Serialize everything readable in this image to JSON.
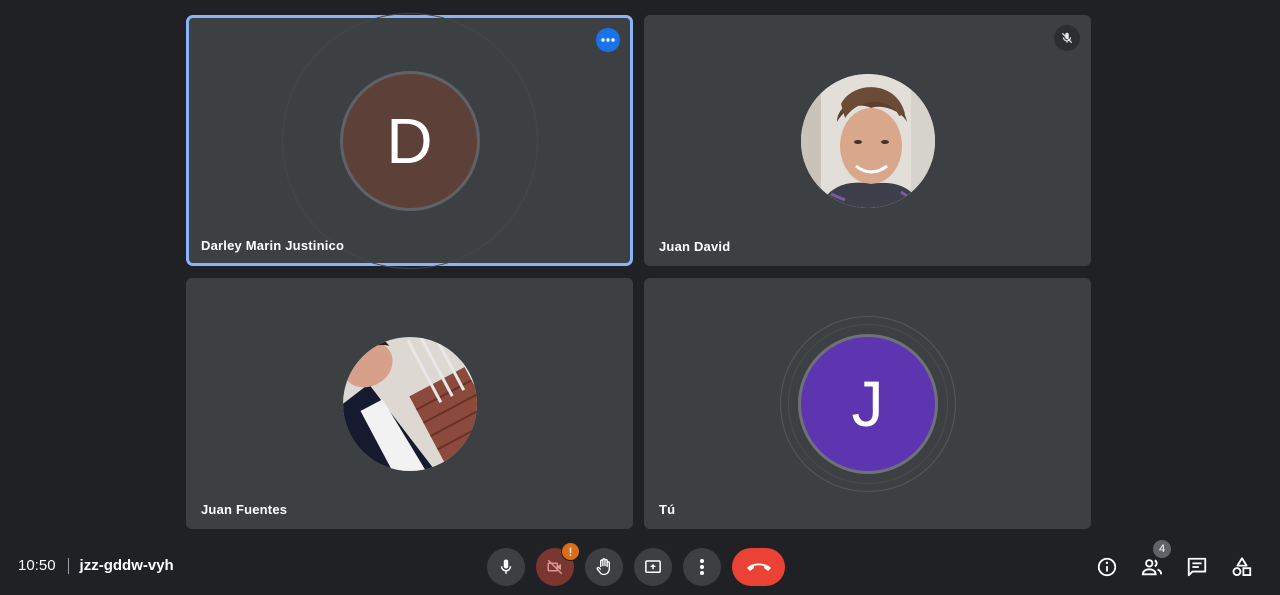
{
  "participants": [
    {
      "name": "Darley Marin Justinico",
      "initial": "D",
      "avatar_color": "#5d4037",
      "active": true
    },
    {
      "name": "Juan David",
      "muted": true
    },
    {
      "name": "Juan Fuentes"
    },
    {
      "name": "Tú",
      "initial": "J",
      "avatar_color": "#5e35b1"
    }
  ],
  "footer": {
    "time": "10:50",
    "meeting_code": "jzz-gddw-vyh",
    "camera_warning": "!",
    "people_count": "4"
  },
  "colors": {
    "background": "#202124",
    "tile": "#3c4043",
    "active_border": "#8ab4f8",
    "danger": "#ea4335",
    "accent": "#1a73e8",
    "warning": "#fa7b17"
  },
  "icons": {
    "controls": [
      "microphone-icon",
      "camera-off-icon",
      "raise-hand-icon",
      "present-screen-icon",
      "more-options-icon",
      "end-call-icon"
    ],
    "right_panel": [
      "info-icon",
      "people-icon",
      "chat-icon",
      "activities-icon"
    ]
  }
}
